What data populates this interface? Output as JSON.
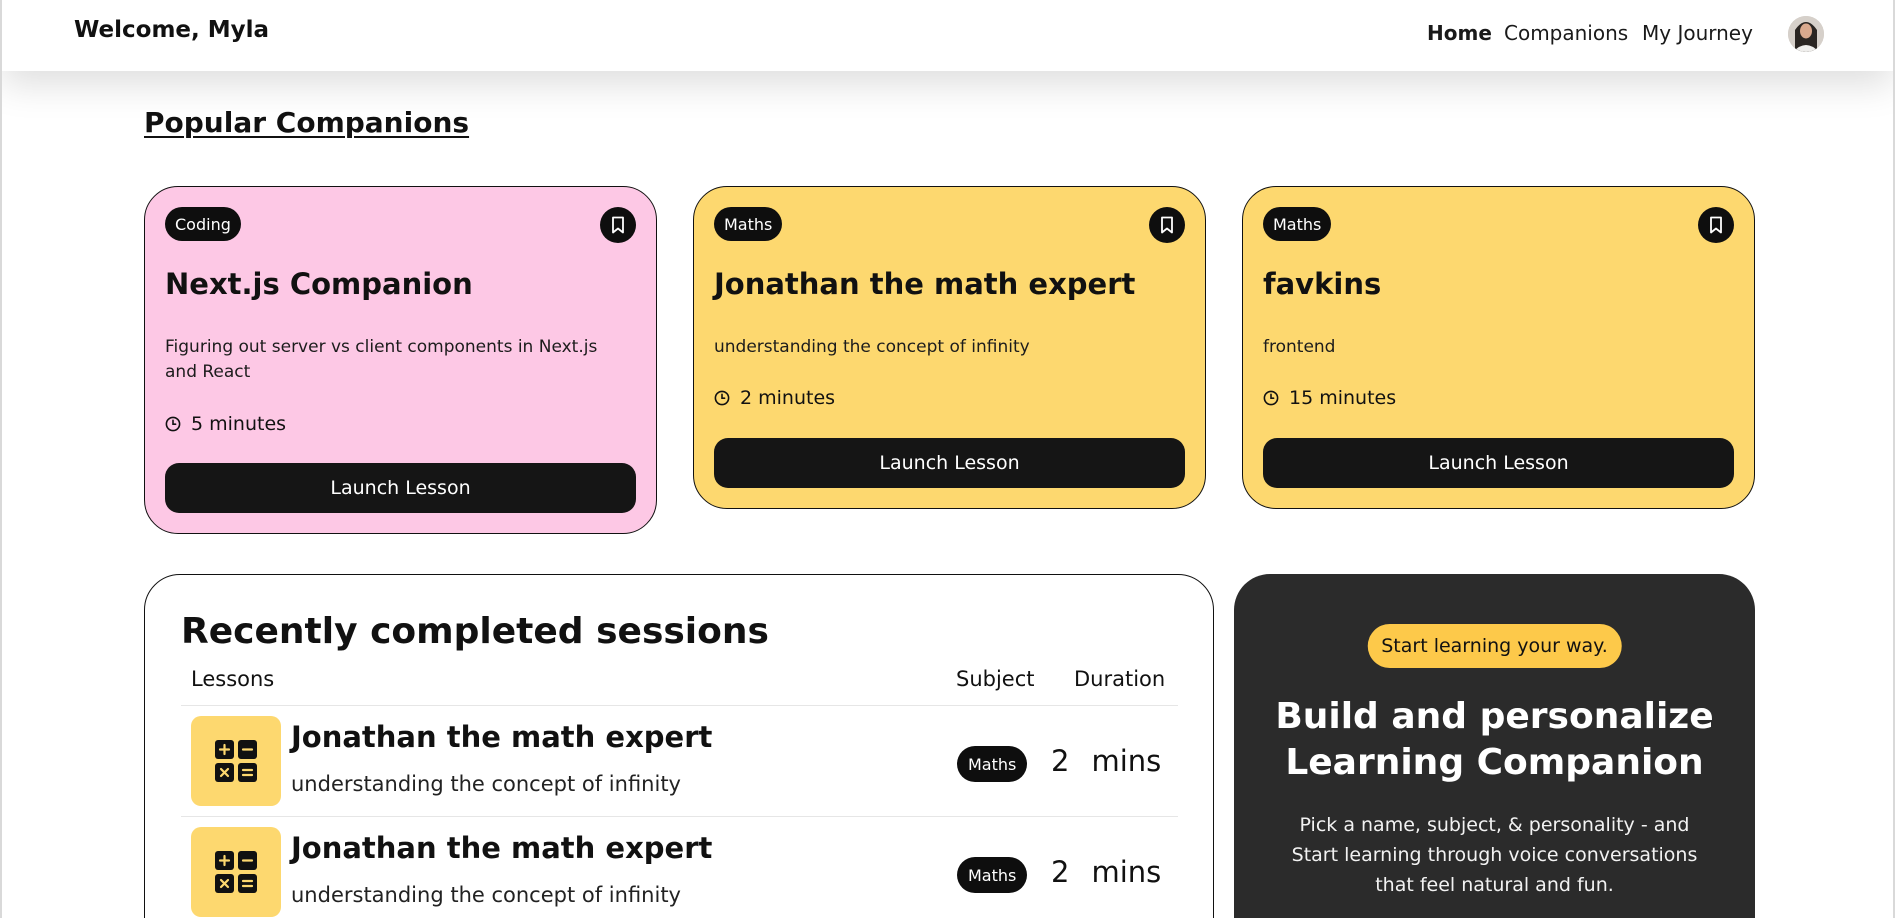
{
  "navbar": {
    "welcome": "Welcome, Myla",
    "links": [
      {
        "label": "Home",
        "active": true
      },
      {
        "label": "Companions",
        "active": false
      },
      {
        "label": "My Journey",
        "active": false
      }
    ]
  },
  "popular": {
    "title": "Popular Companions",
    "cards": [
      {
        "subject": "Coding",
        "name": "Next.js Companion",
        "topic": "Figuring out server vs client components in Next.js and React",
        "duration": "5 minutes",
        "button": "Launch Lesson",
        "color": "#fdc8e5"
      },
      {
        "subject": "Maths",
        "name": "Jonathan the math expert",
        "topic": "understanding the concept of infinity",
        "duration": "2 minutes",
        "button": "Launch Lesson",
        "color": "#fdd86f"
      },
      {
        "subject": "Maths",
        "name": "favkins",
        "topic": "frontend",
        "duration": "15 minutes",
        "button": "Launch Lesson",
        "color": "#fdd86f"
      }
    ]
  },
  "sessions": {
    "title": "Recently completed sessions",
    "headers": {
      "lessons": "Lessons",
      "subject": "Subject",
      "duration": "Duration"
    },
    "rows": [
      {
        "icon": "calculator-icon",
        "name": "Jonathan the math expert",
        "topic": "understanding the concept of infinity",
        "subject": "Maths",
        "duration": "2",
        "unit": "mins"
      },
      {
        "icon": "calculator-icon",
        "name": "Jonathan the math expert",
        "topic": "understanding the concept of infinity",
        "subject": "Maths",
        "duration": "2",
        "unit": "mins"
      }
    ]
  },
  "cta": {
    "badge": "Start learning your way.",
    "title_line1": "Build and personalize",
    "title_line2": "Learning Companion",
    "description": "Pick a name, subject, & personality - and Start learning through voice conversations that feel natural and fun."
  },
  "colors": {
    "pink": "#fdc8e5",
    "yellow": "#fdd86f",
    "dark": "#2b2b2b",
    "accent": "#fdc94a"
  }
}
